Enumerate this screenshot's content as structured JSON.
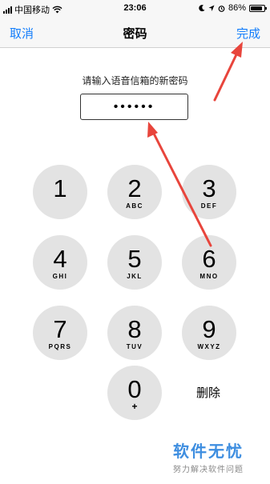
{
  "status_bar": {
    "carrier": "中国移动",
    "time": "23:06",
    "battery": "86%",
    "battery_level": 0.86,
    "icons": [
      "signal-icon",
      "wifi-icon",
      "moon-icon",
      "location-icon",
      "alarm-icon",
      "battery-icon"
    ]
  },
  "nav": {
    "cancel": "取消",
    "title": "密码",
    "done": "完成",
    "accent_color": "#147efb"
  },
  "prompt": "请输入语音信箱的新密码",
  "password_mask": "••••••",
  "keypad": {
    "keys": [
      {
        "digit": "1",
        "letters": ""
      },
      {
        "digit": "2",
        "letters": "ABC"
      },
      {
        "digit": "3",
        "letters": "DEF"
      },
      {
        "digit": "4",
        "letters": "GHI"
      },
      {
        "digit": "5",
        "letters": "JKL"
      },
      {
        "digit": "6",
        "letters": "MNO"
      },
      {
        "digit": "7",
        "letters": "PQRS"
      },
      {
        "digit": "8",
        "letters": "TUV"
      },
      {
        "digit": "9",
        "letters": "WXYZ"
      },
      {
        "digit": "0",
        "letters": "+"
      }
    ],
    "delete": "删除"
  },
  "annotations": {
    "arrow_color": "#e8453c"
  },
  "watermark": {
    "main": "软件无忧",
    "sub": "努力解决软件问题"
  }
}
